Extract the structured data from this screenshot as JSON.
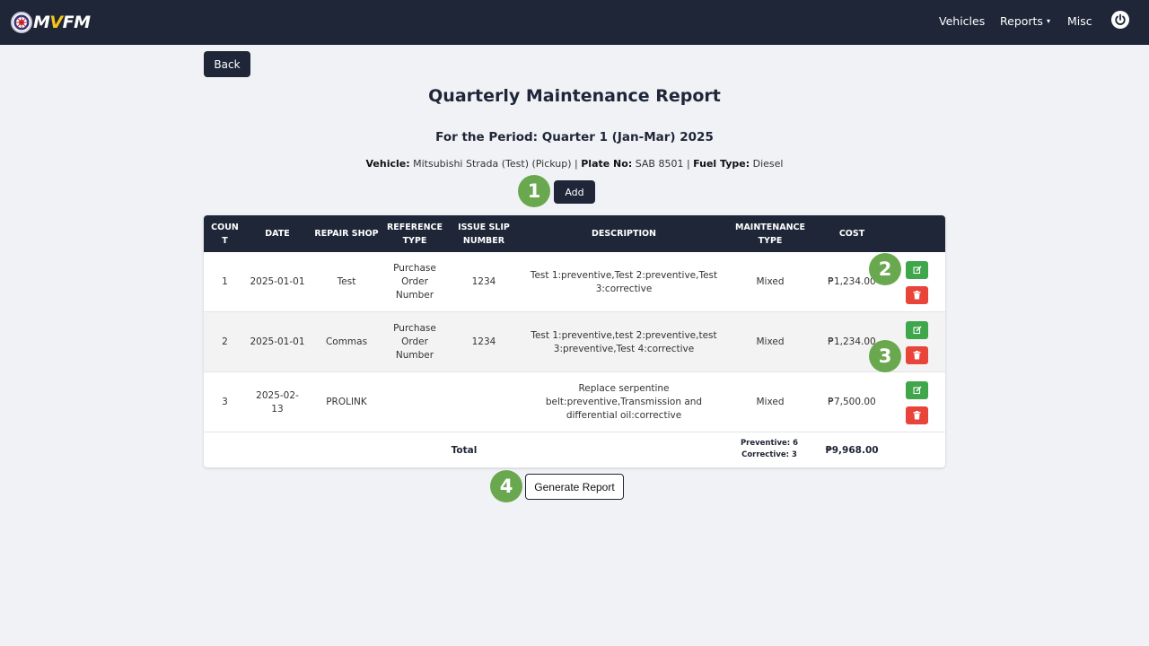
{
  "app": {
    "logo_text_m": "M",
    "logo_text_v": "V",
    "logo_text_rest": "FM"
  },
  "nav": {
    "vehicles": "Vehicles",
    "reports": "Reports",
    "reports_caret": "▾",
    "misc": "Misc"
  },
  "back_label": "Back",
  "title": "Quarterly Maintenance Report",
  "period": "For the Period: Quarter 1 (Jan-Mar) 2025",
  "vehicle_info": {
    "vehicle_label": "Vehicle:",
    "vehicle_value": " Mitsubishi Strada (Test) (Pickup) | ",
    "plate_label": "Plate No:",
    "plate_value": " SAB 8501 | ",
    "fuel_label": "Fuel Type:",
    "fuel_value": " Diesel"
  },
  "add_label": "Add",
  "markers": [
    "1",
    "2",
    "3",
    "4"
  ],
  "table": {
    "headers": {
      "count": "COUN\nT",
      "date": "DATE",
      "repair_shop": "REPAIR SHOP",
      "reference_type": "REFERENCE\nTYPE",
      "issue_slip": "ISSUE SLIP\nNUMBER",
      "description": "DESCRIPTION",
      "maintenance_type": "MAINTENANCE\nTYPE",
      "cost": "COST"
    },
    "rows": [
      {
        "count": "1",
        "date": "2025-01-01",
        "repair_shop": "Test",
        "reference_type": "Purchase\nOrder\nNumber",
        "issue_slip": "1234",
        "description": "Test 1:preventive,Test 2:preventive,Test\n3:corrective",
        "maintenance_type": "Mixed",
        "cost": "₱1,234.00"
      },
      {
        "count": "2",
        "date": "2025-01-01",
        "repair_shop": "Commas",
        "reference_type": "Purchase\nOrder\nNumber",
        "issue_slip": "1234",
        "description": "Test 1:preventive,test 2:preventive,test\n3:preventive,Test 4:corrective",
        "maintenance_type": "Mixed",
        "cost": "₱1,234.00"
      },
      {
        "count": "3",
        "date": "2025-02-\n13",
        "repair_shop": "PROLINK",
        "reference_type": "",
        "issue_slip": "",
        "description": "Replace serpentine\nbelt:preventive,Transmission and\ndifferential oil:corrective",
        "maintenance_type": "Mixed",
        "cost": "₱7,500.00"
      }
    ],
    "total_label": "Total",
    "preventive": "Preventive: 6",
    "corrective": "Corrective: 3",
    "total_cost": "₱9,968.00"
  },
  "generate_label": "Generate Report",
  "colors": {
    "navbar": "#1e2638",
    "marker": "#6aa84f",
    "edit": "#3fa64b",
    "delete": "#e8443a"
  },
  "icons": {
    "power": "power-icon",
    "edit": "edit-icon",
    "delete": "trash-icon"
  }
}
